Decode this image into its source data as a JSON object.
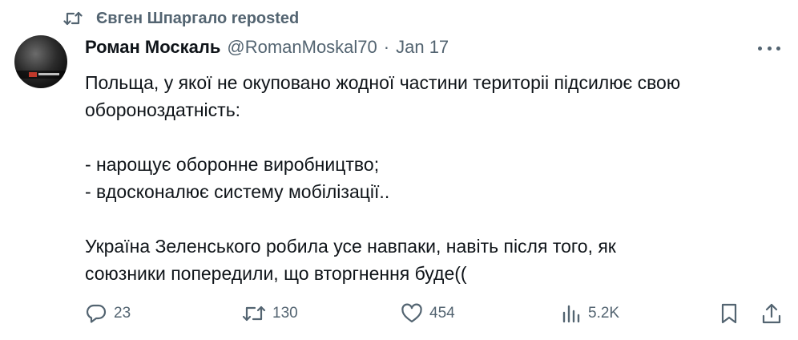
{
  "repost": {
    "icon": "repost-icon",
    "text": "Євген Шпаргало reposted"
  },
  "author": {
    "name": "Роман Москаль",
    "handle": "@RomanMoskal70",
    "separator": "·",
    "date": "Jan 17",
    "avatar_icon": "avatar"
  },
  "more_icon": "more-icon",
  "tweet": {
    "lines": [
      "Польща, у якої не окуповано жодної частини територіі підсилює свою",
      "обороноздатність:",
      "",
      "- нарощує оборонне виробництво;",
      "- вдосконалює систему мобілізації..",
      "",
      "Україна Зеленського робила усе навпаки, навіть після того, як",
      "союзники попередили, що вторгнення буде(("
    ]
  },
  "actions": {
    "reply": {
      "icon": "reply-icon",
      "count": "23"
    },
    "retweet": {
      "icon": "retweet-icon",
      "count": "130"
    },
    "like": {
      "icon": "heart-icon",
      "count": "454"
    },
    "views": {
      "icon": "views-icon",
      "count": "5.2K"
    },
    "bookmark": {
      "icon": "bookmark-icon"
    },
    "share": {
      "icon": "share-icon"
    }
  },
  "colors": {
    "text": "#0f1419",
    "secondary": "#536471",
    "background": "#ffffff"
  }
}
